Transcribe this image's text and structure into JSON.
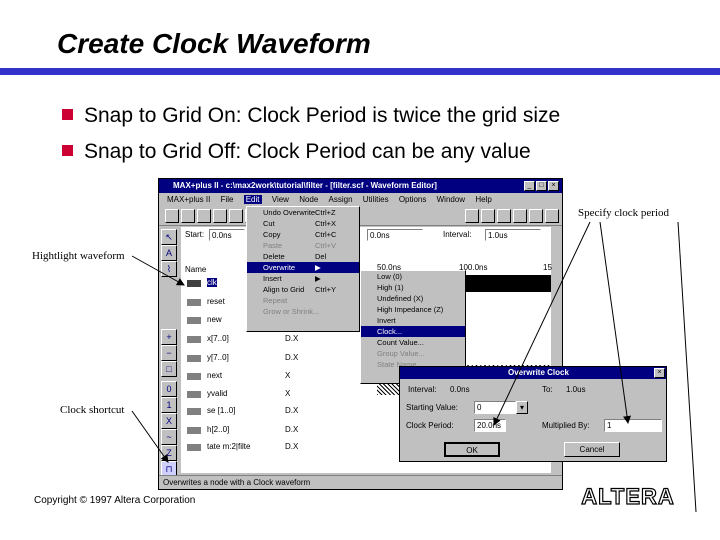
{
  "slide": {
    "title": "Create Clock Waveform",
    "bullets": [
      "Snap to Grid On:  Clock Period is twice the grid size",
      "Snap to Grid Off:  Clock Period can be any value"
    ],
    "callouts": {
      "specify": "Specify clock period",
      "highlight": "Hightlight waveform",
      "shortcut": "Clock shortcut"
    },
    "copyright": "Copyright © 1997 Altera Corporation",
    "logo_text": "ALTERA"
  },
  "window": {
    "title": "MAX+plus II - c:\\max2work\\tutorial\\filter - [filter.scf - Waveform Editor]",
    "menus": [
      "MAX+plus II",
      "File",
      "Edit",
      "View",
      "Node",
      "Assign",
      "Utilities",
      "Options",
      "Window",
      "Help"
    ],
    "start_label": "Start:",
    "start_value": "0.0ns",
    "end_value": "0.0ns",
    "interval_label": "Interval:",
    "interval_value": "1.0us",
    "name_header": "Name",
    "time_ticks": [
      "50.0ns",
      "100.0ns",
      "15"
    ],
    "nodes": [
      "clk",
      "reset",
      "new",
      "x[7..0]",
      "y[7..0]",
      "next",
      "yvalid",
      "se [1..0]",
      "h[2..0]",
      "tate m:2|filte"
    ],
    "values": [
      "",
      "",
      "",
      "D.X",
      "D.X",
      "X",
      "X",
      "D.X",
      "D.X",
      "D.X"
    ],
    "status": "Overwrites a node with a Clock waveform"
  },
  "edit_menu": [
    {
      "label": "Undo Overwrite",
      "shortcut": "Ctrl+Z",
      "state": "normal"
    },
    {
      "label": "Cut",
      "shortcut": "Ctrl+X",
      "state": "normal"
    },
    {
      "label": "Copy",
      "shortcut": "Ctrl+C",
      "state": "normal"
    },
    {
      "label": "Paste",
      "shortcut": "Ctrl+V",
      "state": "disabled"
    },
    {
      "label": "Delete",
      "shortcut": "Del",
      "state": "normal"
    },
    {
      "label": "Overwrite",
      "shortcut": "▶",
      "state": "highlight"
    },
    {
      "label": "Insert",
      "shortcut": "▶",
      "state": "normal"
    },
    {
      "label": "Align to Grid",
      "shortcut": "Ctrl+Y",
      "state": "normal"
    },
    {
      "label": "Repeat",
      "shortcut": "",
      "state": "disabled"
    },
    {
      "label": "Grow or Shrink...",
      "shortcut": "",
      "state": "disabled"
    }
  ],
  "overwrite_menu": [
    {
      "label": "Low (0)",
      "state": "normal"
    },
    {
      "label": "High (1)",
      "state": "normal"
    },
    {
      "label": "Undefined (X)",
      "state": "normal"
    },
    {
      "label": "High Impedance (Z)",
      "state": "normal"
    },
    {
      "label": "Invert",
      "state": "normal"
    },
    {
      "label": "Clock...",
      "state": "highlight"
    },
    {
      "label": "Count Value...",
      "state": "normal"
    },
    {
      "label": "Group Value...",
      "state": "disabled"
    },
    {
      "label": "State Name...",
      "state": "disabled"
    }
  ],
  "dialog": {
    "title": "Overwrite Clock",
    "interval_label": "Interval:",
    "interval_value": "0.0ns",
    "to_label": "To:",
    "to_value": "1.0us",
    "start_label": "Starting Value:",
    "start_value": "0",
    "period_label": "Clock Period:",
    "period_value": "20.0ns",
    "mult_label": "Multiplied By:",
    "mult_value": "1",
    "ok": "OK",
    "cancel": "Cancel"
  },
  "colors": {
    "title_rule": "#3333cc",
    "bullet": "#cc0033",
    "win_title": "#000080"
  }
}
